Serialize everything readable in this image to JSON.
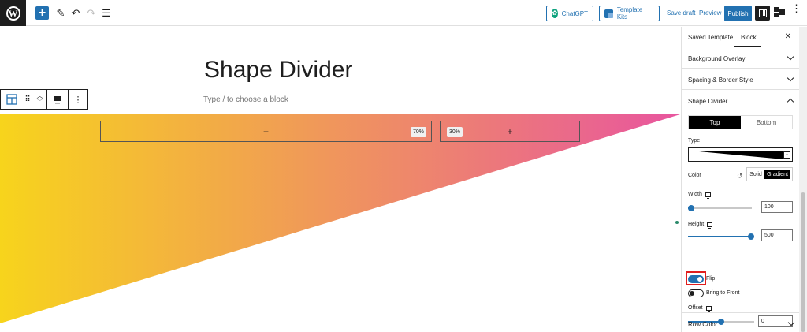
{
  "toolbar": {
    "chatgpt_label": "ChatGPT",
    "template_kits_label": "Template Kits",
    "save_draft_label": "Save draft",
    "preview_label": "Preview",
    "publish_label": "Publish"
  },
  "canvas": {
    "title": "Shape Divider",
    "block_placeholder": "Type / to choose a block",
    "columns": [
      {
        "percent": "70%",
        "add": "+"
      },
      {
        "percent": "30%",
        "add": "+"
      }
    ],
    "gradient": {
      "start": "#f7d41c",
      "end": "#e8559f"
    }
  },
  "sidebar": {
    "tabs": [
      "Saved Template",
      "Block"
    ],
    "active_tab": "Block",
    "close": "✕",
    "panels": {
      "background_overlay": "Background Overlay",
      "spacing_border": "Spacing & Border Style",
      "shape_divider": "Shape Divider",
      "row_color": "Row Color"
    },
    "shape": {
      "position_options": [
        "Top",
        "Bottom"
      ],
      "selected_position": "Top",
      "type_label": "Type",
      "color_label": "Color",
      "color_modes": [
        "Solid",
        "Gradient"
      ],
      "selected_color_mode": "Gradient",
      "width_label": "Width",
      "width_value": "100",
      "width_fraction": 0.0,
      "height_label": "Height",
      "height_value": "500",
      "height_fraction": 1.0,
      "flip_label": "Flip",
      "flip_on": true,
      "bring_front_label": "Bring to Front",
      "bring_front_on": false,
      "offset_label": "Offset",
      "offset_value": "0",
      "offset_fraction": 0.5
    }
  },
  "colors": {
    "accent": "#2271b1",
    "highlight": "#e01e1e"
  }
}
